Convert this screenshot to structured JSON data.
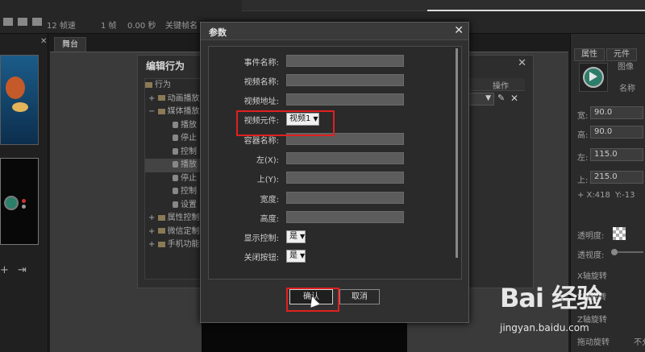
{
  "toolbar": {
    "fps": "12 帧速",
    "frame": "1 帧",
    "time": "0.00 秒",
    "keyframe_name": "关键帧名"
  },
  "stage": {
    "tab_label": "舞台"
  },
  "behavior_panel": {
    "title": "编辑行为",
    "close": "✕",
    "op_header": "操作",
    "tree": [
      {
        "label": "行为",
        "type": "root"
      },
      {
        "label": "动画播放",
        "type": "folder",
        "expand": "+"
      },
      {
        "label": "媒体播放",
        "type": "folder",
        "expand": "−"
      },
      {
        "label": "播放",
        "type": "leaf"
      },
      {
        "label": "停止",
        "type": "leaf"
      },
      {
        "label": "控制",
        "type": "leaf"
      },
      {
        "label": "播放",
        "type": "leaf",
        "selected": true
      },
      {
        "label": "停止",
        "type": "leaf"
      },
      {
        "label": "控制",
        "type": "leaf"
      },
      {
        "label": "设置",
        "type": "leaf"
      },
      {
        "label": "属性控制",
        "type": "folder",
        "expand": "+"
      },
      {
        "label": "微信定制",
        "type": "folder",
        "expand": "+"
      },
      {
        "label": "手机功能",
        "type": "folder",
        "expand": "+"
      }
    ]
  },
  "right_panel": {
    "tab_props": "属性",
    "tab_element": "元件",
    "img_label": "图像",
    "name_label": "名称",
    "width_label": "宽:",
    "width_value": "90.0",
    "height_label": "高:",
    "height_value": "90.0",
    "left_label": "左:",
    "left_value": "115.0",
    "top_label": "上:",
    "top_value": "215.0",
    "x_readout": "+ X:418",
    "y_readout": "Y:-13",
    "opacity_label": "透明度:",
    "perspective_label": "透视度:",
    "xrot_label": "X轴旋转",
    "yrot_label": "Y轴旋转",
    "zrot_label": "Z轴旋转",
    "rotate_label": "拖动旋转",
    "rotate_value": "不允"
  },
  "dialog": {
    "title": "参数",
    "close": "✕",
    "fields": [
      {
        "label": "事件名称:",
        "kind": "text",
        "value": ""
      },
      {
        "label": "视频名称:",
        "kind": "text",
        "value": ""
      },
      {
        "label": "视频地址:",
        "kind": "text",
        "value": ""
      },
      {
        "label": "视频元件:",
        "kind": "select",
        "value": "视频1"
      },
      {
        "label": "容器名称:",
        "kind": "text",
        "value": ""
      },
      {
        "label": "左(X):",
        "kind": "text",
        "value": ""
      },
      {
        "label": "上(Y):",
        "kind": "text",
        "value": ""
      },
      {
        "label": "宽度:",
        "kind": "text",
        "value": ""
      },
      {
        "label": "高度:",
        "kind": "text",
        "value": ""
      },
      {
        "label": "显示控制:",
        "kind": "select",
        "value": "是"
      },
      {
        "label": "关闭按钮:",
        "kind": "select",
        "value": "是"
      }
    ],
    "ok_label": "确认",
    "cancel_label": "取消"
  },
  "watermark": {
    "logo": "Bai 经验",
    "url": "jingyan.baidu.com"
  },
  "colors": {
    "highlight": "#e02020",
    "input_bg": "#5c5c5c",
    "dialog_bg": "#303030"
  }
}
